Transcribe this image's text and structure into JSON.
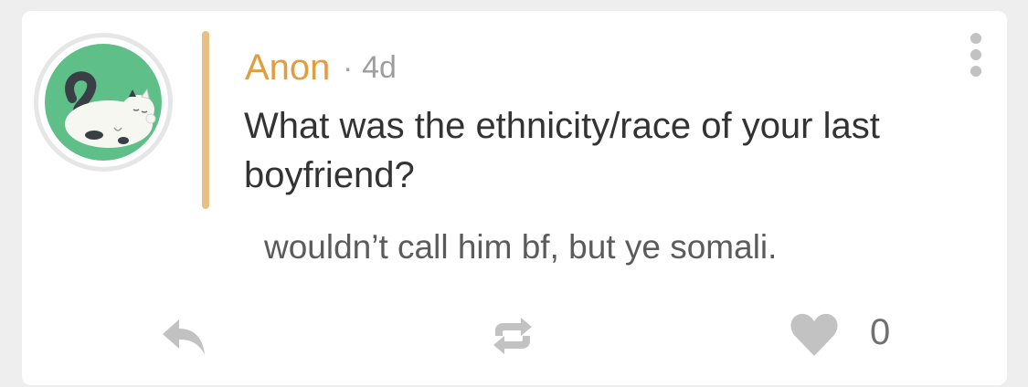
{
  "post": {
    "author": "Anon",
    "separator": "·",
    "age": "4d",
    "question": "What was the ethnicity/race of your last boyfriend?",
    "answer": "wouldn’t call him bf, but ye somali.",
    "like_count": "0",
    "avatar": {
      "description_icon": "cat-icon",
      "background_color": "#5ec088"
    },
    "accent_color": "#e6c183",
    "author_color": "#df9e42"
  },
  "actions": {
    "reply_icon": "reply-icon",
    "repost_icon": "repost-icon",
    "like_icon": "heart-icon",
    "menu_icon": "more-vertical-icon"
  }
}
